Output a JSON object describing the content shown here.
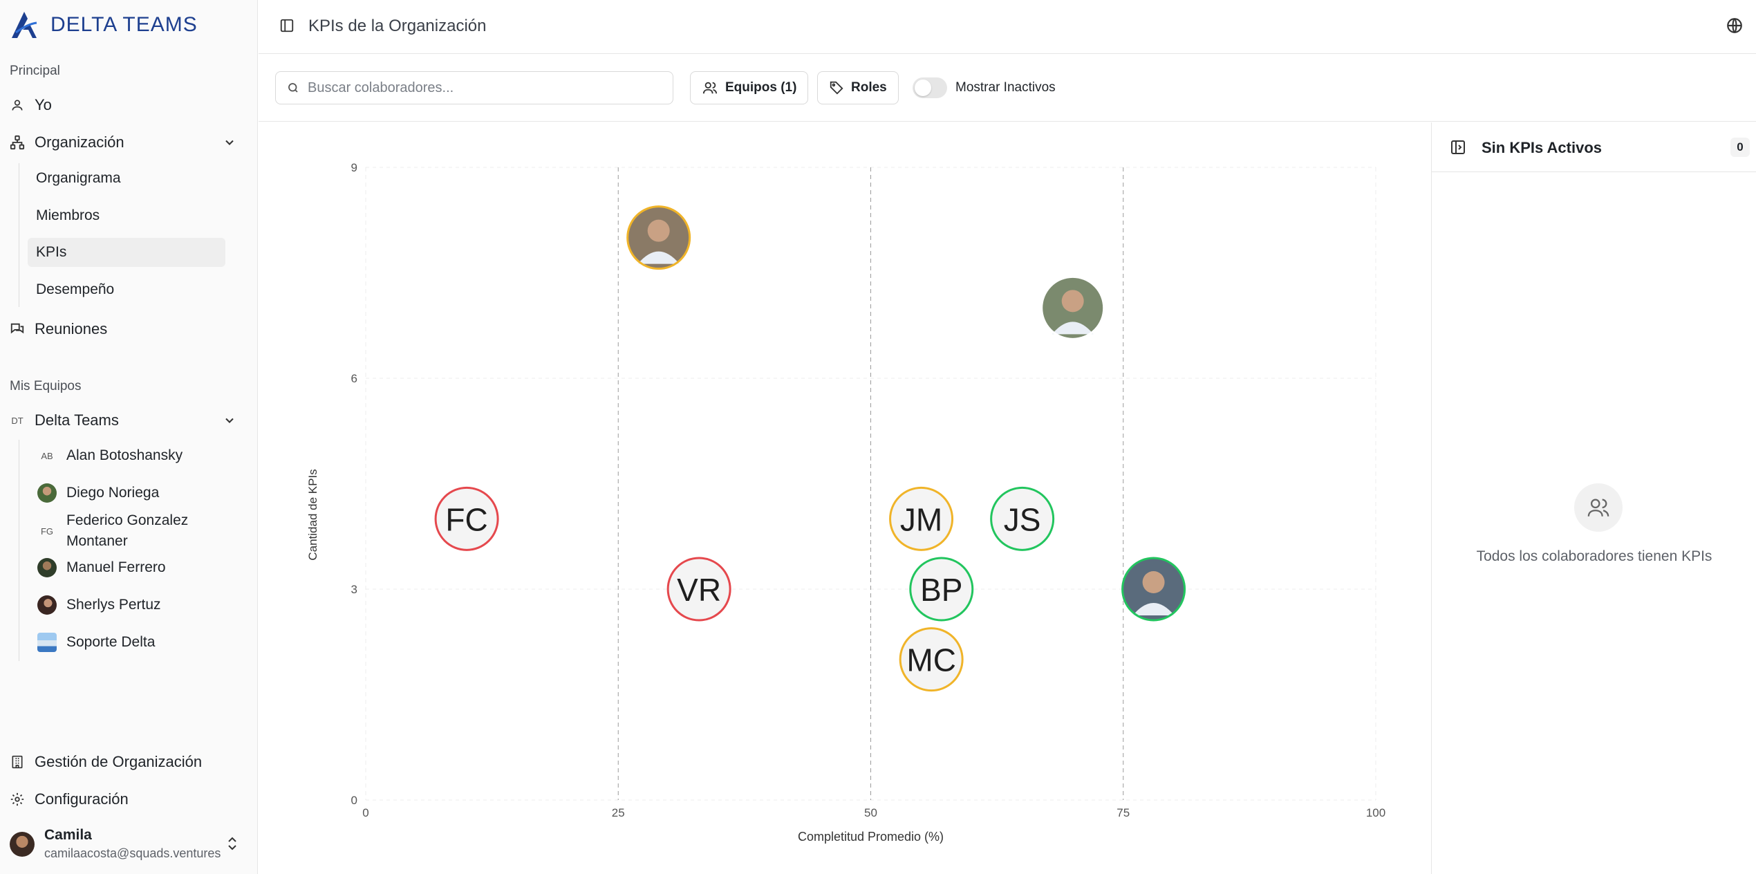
{
  "app": {
    "brand": "DELTA TEAMS"
  },
  "sidebar": {
    "principal_label": "Principal",
    "yo": "Yo",
    "organizacion": "Organización",
    "org_items": [
      "Organigrama",
      "Miembros",
      "KPIs",
      "Desempeño"
    ],
    "active_item": "KPIs",
    "reuniones": "Reuniones",
    "mis_equipos_label": "Mis Equipos",
    "team": {
      "initials": "DT",
      "name": "Delta Teams"
    },
    "members": [
      {
        "initials": "AB",
        "name": "Alan Botoshansky",
        "photo": false
      },
      {
        "initials": "",
        "name": "Diego Noriega",
        "photo": true
      },
      {
        "initials": "FG",
        "name": "Federico Gonzalez",
        "name2": "Montaner",
        "photo": false
      },
      {
        "initials": "",
        "name": "Manuel Ferrero",
        "photo": true
      },
      {
        "initials": "",
        "name": "Sherlys Pertuz",
        "photo": true
      },
      {
        "initials": "",
        "name": "Soporte Delta",
        "photo": true
      }
    ],
    "gestion": "Gestión de Organización",
    "configuracion": "Configuración",
    "user": {
      "name": "Camila",
      "email": "camilaacosta@squads.ventures"
    }
  },
  "header": {
    "title": "KPIs de la Organización"
  },
  "toolbar": {
    "search_placeholder": "Buscar colaboradores...",
    "equipos_label": "Equipos (1)",
    "roles_label": "Roles",
    "mostrar_inactivos": "Mostrar Inactivos",
    "mostrar_inactivos_on": false
  },
  "right_panel": {
    "title": "Sin KPIs Activos",
    "count": "0",
    "empty_text": "Todos los colaboradores tienen KPIs"
  },
  "colors": {
    "red": "#e5484d",
    "amber": "#f0b429",
    "green": "#22c55e",
    "brand": "#1d3f8f"
  },
  "chart_data": {
    "type": "scatter",
    "xlabel": "Completitud Promedio (%)",
    "ylabel": "Cantidad de KPIs",
    "xlim": [
      0,
      100
    ],
    "ylim": [
      0,
      9
    ],
    "x_ticks": [
      "0",
      "25",
      "50",
      "75",
      "100"
    ],
    "y_ticks": [
      "0",
      "3",
      "6",
      "9"
    ],
    "points": [
      {
        "label": "",
        "x": 29,
        "y": 8,
        "status": "amber",
        "photo": true
      },
      {
        "label": "",
        "x": 70,
        "y": 7,
        "status": "none",
        "photo": true
      },
      {
        "label": "FC",
        "x": 10,
        "y": 4,
        "status": "red",
        "photo": false
      },
      {
        "label": "JM",
        "x": 55,
        "y": 4,
        "status": "amber",
        "photo": false
      },
      {
        "label": "JS",
        "x": 65,
        "y": 4,
        "status": "green",
        "photo": false
      },
      {
        "label": "VR",
        "x": 33,
        "y": 3,
        "status": "red",
        "photo": false
      },
      {
        "label": "BP",
        "x": 57,
        "y": 3,
        "status": "green",
        "photo": false
      },
      {
        "label": "",
        "x": 78,
        "y": 3,
        "status": "green",
        "photo": true
      },
      {
        "label": "MC",
        "x": 56,
        "y": 2,
        "status": "amber",
        "photo": false
      }
    ]
  }
}
